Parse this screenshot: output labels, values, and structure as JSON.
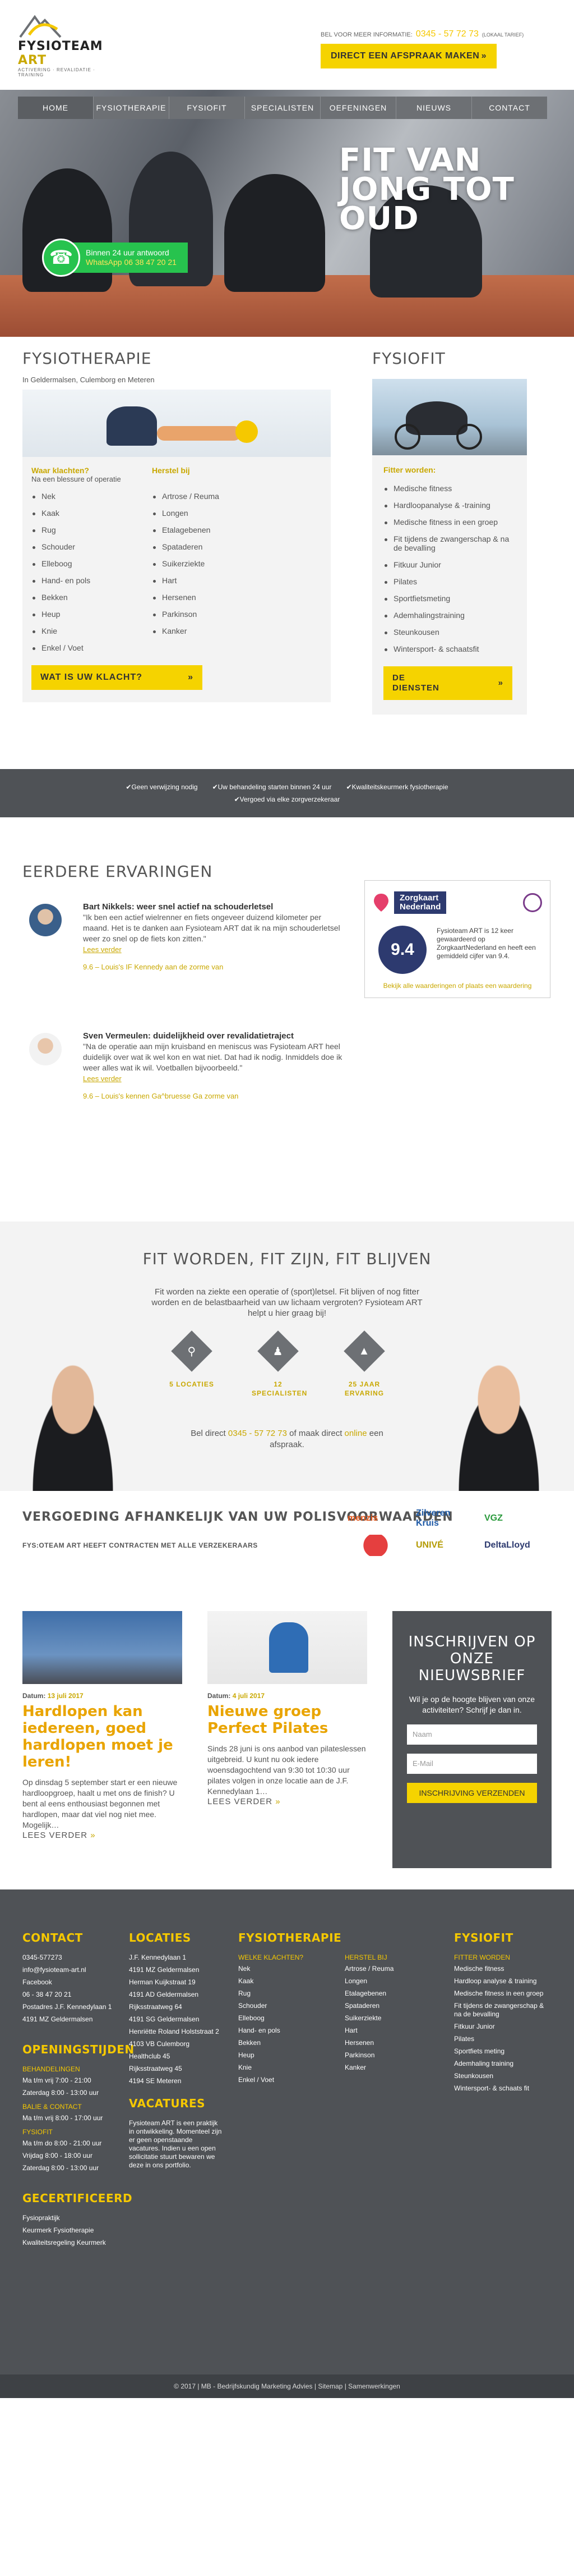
{
  "header": {
    "brand_main": "FYSIOTEAM",
    "brand_accent": "ART",
    "tagline": "ACTIVERING · REVALIDATIE · TRAINING",
    "phone_label": "BEL VOOR MEER INFORMATIE:",
    "phone": "0345 - 57 72 73",
    "phone_note": "(LOKAAL TARIEF)",
    "appointment_btn": "DIRECT EEN AFSPRAAK MAKEN"
  },
  "nav": [
    {
      "label": "HOME",
      "active": true
    },
    {
      "label": "FYSIOTHERAPIE"
    },
    {
      "label": "FYSIOFIT"
    },
    {
      "label": "SPECIALISTEN"
    },
    {
      "label": "OEFENINGEN"
    },
    {
      "label": "NIEUWS"
    },
    {
      "label": "CONTACT"
    }
  ],
  "hero": {
    "line1": "FIT VAN",
    "line2": "JONG TOT",
    "line3": "OUD"
  },
  "whatsapp": {
    "line1": "Binnen 24 uur antwoord",
    "line2": "WhatsApp 06 38 47 20 21"
  },
  "fysio": {
    "title": "FYSIOTHERAPIE",
    "sub": "In Geldermalsen, Culemborg en Meteren",
    "col1_title": "Waar klachten?",
    "col1_sub": "Na een blessure of operatie",
    "col2_title": "Herstel bij",
    "col1": [
      "Nek",
      "Kaak",
      "Rug",
      "Schouder",
      "Elleboog",
      "Hand- en pols",
      "Bekken",
      "Heup",
      "Knie",
      "Enkel / Voet"
    ],
    "col2": [
      "Artrose / Reuma",
      "Longen",
      "Etalagebenen",
      "Spataderen",
      "Suikerziekte",
      "Hart",
      "Hersenen",
      "Parkinson",
      "Kanker"
    ],
    "button": "WAT IS UW KLACHT?"
  },
  "fysiofit": {
    "title": "FYSIOFIT",
    "subtitle": "Fitter worden:",
    "items": [
      "Medische fitness",
      "Hardloopanalyse & -training",
      "Medische fitness in een groep",
      "Fit tijdens de zwangerschap & na de bevalling",
      "Fitkuur Junior",
      "Pilates",
      "Sportfietsmeting",
      "Ademhalingstraining",
      "Steunkousen",
      "Wintersport- & schaatsfit"
    ],
    "button_l1": "DE",
    "button_l2": "DIENSTEN"
  },
  "strip": {
    "row1": [
      "Geen verwijzing nodig",
      "Uw behandeling starten binnen 24 uur",
      "Kwaliteitskeurmerk fysiotherapie"
    ],
    "row2": [
      "Vergoed via elke zorgverzekeraar"
    ]
  },
  "reviews": {
    "title": "EERDERE ERVARINGEN",
    "items": [
      {
        "title": "Bart Nikkels: weer snel actief na schouderletsel",
        "text": "\"Ik ben een actief wielrenner en fiets ongeveer duizend kilometer per maand. Het is te danken aan Fysioteam ART dat ik na mijn schouderletsel weer zo snel op de fiets kon zitten.\"",
        "more": "Lees verder",
        "score": "9.6 – Louis's IF Kennedy aan de zorme van"
      },
      {
        "title": "Sven Vermeulen: duidelijkheid over revalidatietraject",
        "text": "\"Na de operatie aan mijn kruisband en meniscus was Fysioteam ART heel duidelijk over wat ik wel kon en wat niet. Dat had ik nodig. Inmiddels doe ik weer alles wat ik wil. Voetballen bijvoorbeeld.\"",
        "more": "Lees verder",
        "score": "9.6 – Louis's kennen Ga^bruesse Ga zorme van"
      }
    ],
    "zorgkaart": {
      "name": "Zorgkaart",
      "name2": "Nederland",
      "score": "9.4",
      "text": "Fysioteam ART is 12 keer gewaardeerd op ZorgkaartNederland en heeft een gemiddeld cijfer van 9.4.",
      "link": "Bekijk alle waarderingen of plaats een waardering"
    }
  },
  "fitworden": {
    "title": "FIT WORDEN, FIT ZIJN, FIT BLIJVEN",
    "text": "Fit worden na ziekte een operatie of (sport)letsel. Fit blijven of nog fitter worden en de belastbaarheid van uw lichaam vergroten? Fysioteam ART helpt u hier graag bij!",
    "stats": [
      "5 LOCATIES",
      "12 SPECIALISTEN",
      "25 JAAR ERVARING"
    ],
    "call_pre": "Bel direct",
    "call_phone": "0345 - 57 72 73",
    "call_mid": "of maak direct",
    "call_link": "online",
    "call_post": "een afspraak."
  },
  "insurance": {
    "title": "VERGOEDING AFHANKELIJK VAN UW POLISVOORWAARDEN",
    "text": "FYS:OTEAM ART HEEFT CONTRACTEN MET ALLE VERZEKERAARS",
    "logos": [
      "menzis",
      "Zilveren Kruis",
      "VGZ",
      "",
      "UNIVÉ",
      "DeltaLloyd"
    ]
  },
  "news": [
    {
      "date_label": "Datum:",
      "date": "13 juli 2017",
      "title": "Hardlopen kan iedereen, goed hardlopen moet je leren!",
      "text": "Op dinsdag 5 september start er een nieuwe hardloopgroep, haalt u met ons de finish? U bent al eens enthousiast begonnen met hardlopen, maar dat viel nog niet mee. Mogelijk…",
      "more": "LEES VERDER"
    },
    {
      "date_label": "Datum:",
      "date": "4 juli 2017",
      "title": "Nieuwe groep Perfect Pilates",
      "text": "Sinds 28 juni is ons aanbod van pilateslessen uitgebreid. U kunt nu ook iedere woensdagochtend van 9:30 tot 10:30 uur pilates volgen in onze locatie aan de J.F. Kennedylaan 1…",
      "more": "LEES VERDER"
    }
  ],
  "newsletter": {
    "title": "INSCHRIJVEN OP ONZE NIEUWSBRIEF",
    "text": "Wil je op de hoogte blijven van onze activiteiten? Schrijf je dan in.",
    "name_ph": "Naam",
    "email_ph": "E-Mail",
    "button": "INSCHRIJVING VERZENDEN"
  },
  "footer": {
    "contact": {
      "title": "CONTACT",
      "lines": [
        "0345-577273",
        "info@fysioteam-art.nl",
        "Facebook",
        "06 - 38 47 20 21",
        "Postadres J.F. Kennedylaan 1",
        "4191 MZ Geldermalsen"
      ]
    },
    "hours": {
      "title": "OPENINGSTIJDEN",
      "g1": "BEHANDELINGEN",
      "g1l": [
        "Ma t/m vrij 7:00 - 21:00",
        "Zaterdag 8:00 - 13:00 uur"
      ],
      "g2": "BALIE & CONTACT",
      "g2l": [
        "Ma t/m vrij 8:00 - 17:00 uur"
      ],
      "g3": "FYSIOFIT",
      "g3l": [
        "Ma t/m do 8:00 - 21:00 uur",
        "Vrijdag 8:00 - 18:00 uur",
        "Zaterdag 8:00 - 13:00 uur"
      ]
    },
    "cert": {
      "title": "GECERTIFICEERD",
      "lines": [
        "Fysiopraktijk",
        "Keurmerk Fysiotherapie",
        "Kwaliteitsregeling Keurmerk"
      ]
    },
    "locaties": {
      "title": "LOCATIES",
      "lines": [
        "J.F. Kennedylaan 1",
        "4191 MZ Geldermalsen",
        "Herman Kuijkstraat 19",
        "4191 AD Geldermalsen",
        "Rijksstraatweg 64",
        "4191 SG Geldermalsen",
        "Henriëtte Roland Holststraat 2",
        "4103 VB Culemborg",
        "Healthclub 45",
        "Rijksstraatweg 45",
        "4194 SE Meteren"
      ]
    },
    "vac": {
      "title": "VACATURES",
      "text": "Fysioteam ART is een praktijk in ontwikkeling. Momenteel zijn er geen openstaande vacatures. Indien u een open sollicitatie stuurt bewaren we deze in ons portfolio."
    },
    "fysio": {
      "title": "FYSIOTHERAPIE",
      "sub1": "WELKE KLACHTEN?",
      "col1": [
        "Nek",
        "Kaak",
        "Rug",
        "Schouder",
        "Elleboog",
        "Hand- en pols",
        "Bekken",
        "Heup",
        "Knie",
        "Enkel / Voet"
      ],
      "sub2": "HERSTEL BIJ",
      "col2": [
        "Artrose / Reuma",
        "Longen",
        "Etalagebenen",
        "Spataderen",
        "Suikerziekte",
        "Hart",
        "Hersenen",
        "Parkinson",
        "Kanker"
      ]
    },
    "fit": {
      "title": "FYSIOFIT",
      "sub": "FITTER WORDEN",
      "items": [
        "Medische fitness",
        "Hardloop analyse & training",
        "Medische fitness in een groep",
        "Fit tijdens de zwangerschap & na de bevalling",
        "Fitkuur Junior",
        "Pilates",
        "Sportfiets meting",
        "Ademhaling training",
        "Steunkousen",
        "Wintersport- & schaats fit"
      ]
    },
    "copyright": "© 2017 | MB - Bedrijfskundig Marketing Advies | Sitemap | Samenwerkingen"
  }
}
